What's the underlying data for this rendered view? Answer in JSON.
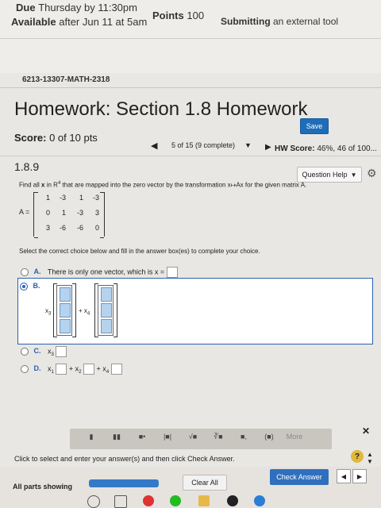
{
  "header": {
    "due_label": "Due",
    "due_value": "Thursday by 11:30pm",
    "points_label": "Points",
    "points_value": "100",
    "available_label": "Available",
    "available_value": "after Jun 11 at 5am",
    "submitting_label": "Submitting",
    "submitting_value": "an external tool"
  },
  "course": {
    "code": "6213-13307-MATH-2318"
  },
  "homework": {
    "title": "Homework: Section 1.8 Homework",
    "save_label": "Save",
    "score_label": "Score:",
    "score_value": "0 of 10 pts",
    "nav_text": "5 of 15 (9 complete)",
    "hw_score_label": "HW Score:",
    "hw_score_value": "46%, 46 of 100..."
  },
  "question": {
    "number": "1.8.9",
    "help_label": "Question Help",
    "prompt_part1": "Find all",
    "prompt_bold_x": "x",
    "prompt_part2": "in R",
    "prompt_sup": "4",
    "prompt_part3": "that are mapped into the zero vector by the transformation x↦Ax for the given matrix A.",
    "matrix_label": "A =",
    "matrix": [
      [
        "1",
        "-3",
        "1",
        "-3"
      ],
      [
        "0",
        "1",
        "-3",
        "3"
      ],
      [
        "3",
        "-6",
        "-6",
        "0"
      ]
    ],
    "instruction": "Select the correct choice below and fill in the answer box(es) to complete your choice.",
    "choice_a_letter": "A.",
    "choice_a_text": "There is only one vector, which is x =",
    "choice_b_letter": "B.",
    "choice_b_var1": "x",
    "choice_b_var1_sub": "3",
    "choice_b_plus": "+ x",
    "choice_b_var2_sub": "4",
    "choice_c_letter": "C.",
    "choice_c_var": "x",
    "choice_c_sub": "3",
    "choice_d_letter": "D.",
    "choice_d_x1": "x",
    "choice_d_x1_sub": "1",
    "choice_d_x2": "+ x",
    "choice_d_x2_sub": "2",
    "choice_d_x4": "+ x",
    "choice_d_x4_sub": "4",
    "selected_choice": "B"
  },
  "toolbar": {
    "more_label": "More"
  },
  "footer": {
    "click_instruction": "Click to select and enter your answer(s) and then click Check Answer.",
    "help_badge": "?",
    "all_parts_label": "All parts showing",
    "clear_all_label": "Clear All",
    "check_answer_label": "Check Answer",
    "progress_fraction": 1.0
  },
  "colors": {
    "accent": "#2a61b0",
    "save_button": "#1f6db8",
    "check_button": "#2f6fbd",
    "help_badge": "#e0b83a"
  }
}
